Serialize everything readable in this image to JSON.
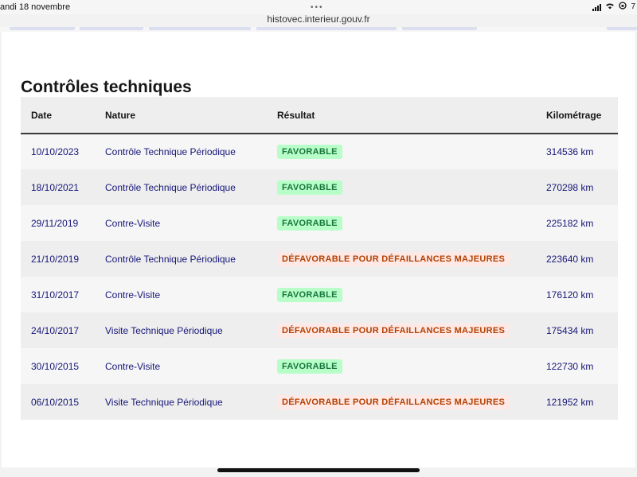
{
  "status_bar": {
    "date": "andi 18 novembre",
    "battery": "7"
  },
  "browser": {
    "url": "histovec.interieur.gouv.fr"
  },
  "section": {
    "title": "Contrôles techniques"
  },
  "table": {
    "headers": {
      "date": "Date",
      "nature": "Nature",
      "result": "Résultat",
      "mileage": "Kilométrage"
    },
    "rows": [
      {
        "date": "10/10/2023",
        "nature": "Contrôle Technique Périodique",
        "result": "FAVORABLE",
        "status": "ok",
        "mileage": "314536 km"
      },
      {
        "date": "18/10/2021",
        "nature": "Contrôle Technique Périodique",
        "result": "FAVORABLE",
        "status": "ok",
        "mileage": "270298 km"
      },
      {
        "date": "29/11/2019",
        "nature": "Contre-Visite",
        "result": "FAVORABLE",
        "status": "ok",
        "mileage": "225182 km"
      },
      {
        "date": "21/10/2019",
        "nature": "Contrôle Technique Périodique",
        "result": "DÉFAVORABLE POUR DÉFAILLANCES MAJEURES",
        "status": "ko",
        "mileage": "223640 km"
      },
      {
        "date": "31/10/2017",
        "nature": "Contre-Visite",
        "result": "FAVORABLE",
        "status": "ok",
        "mileage": "176120 km"
      },
      {
        "date": "24/10/2017",
        "nature": "Visite Technique Périodique",
        "result": "DÉFAVORABLE POUR DÉFAILLANCES MAJEURES",
        "status": "ko",
        "mileage": "175434 km"
      },
      {
        "date": "30/10/2015",
        "nature": "Contre-Visite",
        "result": "FAVORABLE",
        "status": "ok",
        "mileage": "122730 km"
      },
      {
        "date": "06/10/2015",
        "nature": "Visite Technique Périodique",
        "result": "DÉFAVORABLE POUR DÉFAILLANCES MAJEURES",
        "status": "ko",
        "mileage": "121952 km"
      }
    ]
  },
  "colors": {
    "favorable_bg": "#b8fec9",
    "favorable_text": "#18753c",
    "defavorable_bg": "#ffe9e6",
    "defavorable_text": "#b34000",
    "link_text": "#161679"
  }
}
